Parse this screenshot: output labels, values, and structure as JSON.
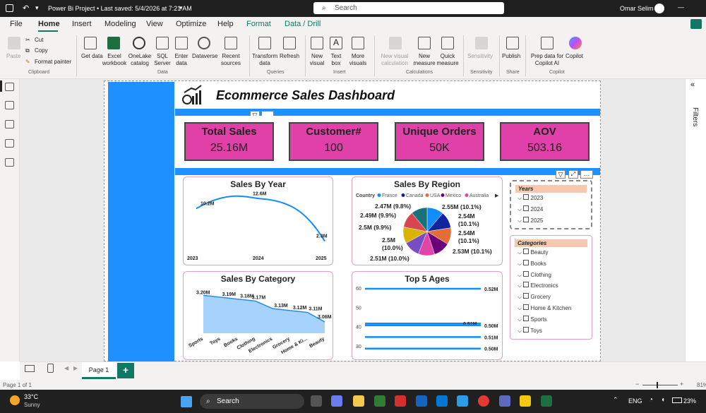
{
  "titlebar": {
    "title": "Power Bi Project • Last saved: 5/4/2026 at 7:21 AM",
    "search": "Search",
    "user": "Omar Selim"
  },
  "menu": [
    "File",
    "Home",
    "Insert",
    "Modeling",
    "View",
    "Optimize",
    "Help",
    "Format",
    "Data / Drill"
  ],
  "ribbon": {
    "clipboard": {
      "paste": "Paste",
      "cut": "Cut",
      "copy": "Copy",
      "format_painter": "Format painter",
      "group": "Clipboard"
    },
    "data": {
      "get_data": "Get data",
      "excel": "Excel workbook",
      "onelake": "OneLake catalog",
      "sql": "SQL Server",
      "enter": "Enter data",
      "dataverse": "Dataverse",
      "recent": "Recent sources",
      "group": "Data"
    },
    "queries": {
      "transform": "Transform data",
      "refresh": "Refresh",
      "group": "Queries"
    },
    "insert": {
      "new_visual": "New visual",
      "text_box": "Text box",
      "more_visuals": "More visuals",
      "group": "Insert"
    },
    "calculations": {
      "new_visual_calc": "New visual calculation",
      "new_measure": "New measure",
      "quick_measure": "Quick measure",
      "group": "Calculations"
    },
    "sensitivity": {
      "label": "Sensitivity",
      "group": "Sensitivity"
    },
    "share": {
      "publish": "Publish",
      "group": "Share"
    },
    "copilot": {
      "prep": "Prep data for Copilot AI",
      "copilot": "Copilot",
      "group": "Copilot"
    }
  },
  "dashboard": {
    "title": "Ecommerce Sales Dashboard",
    "kpis": [
      {
        "title": "Total Sales",
        "value": "25.16M"
      },
      {
        "title": "Customer#",
        "value": "100"
      },
      {
        "title": "Unique Orders",
        "value": "50K"
      },
      {
        "title": "AOV",
        "value": "503.16"
      }
    ]
  },
  "charts": {
    "sales_by_year": {
      "title": "Sales By Year",
      "type": "line",
      "categories": [
        "2023",
        "2024",
        "2025"
      ],
      "values": [
        10.2,
        12.6,
        2.3
      ],
      "labels": [
        "10.2M",
        "12.6M",
        "2.3M"
      ]
    },
    "sales_by_region": {
      "title": "Sales By Region",
      "type": "pie",
      "legend_title": "Country",
      "legend": [
        "France",
        "Canada",
        "USA",
        "Mexico",
        "Australia"
      ],
      "labels": [
        "2.55M (10.1%)",
        "2.54M (10.1%)",
        "2.54M (10.1%)",
        "2.53M (10.1%)",
        "2.51M (10.0%)",
        "2.5M (10.0%)",
        "2.5M (9.9%)",
        "2.49M (9.9%)",
        "2.47M (9.8%)"
      ],
      "label_lines": [
        [
          "2.55M (10.1%)"
        ],
        [
          "2.54M",
          "(10.1%)"
        ],
        [
          "2.54M",
          "(10.1%)"
        ],
        [
          "2.53M (10.1%)"
        ],
        [
          "2.51M (10.0%)"
        ],
        [
          "2.5M",
          "(10.0%)"
        ],
        [
          "2.5M (9.9%)"
        ],
        [
          "2.49M (9.9%)"
        ],
        [
          "2.47M (9.8%)"
        ]
      ],
      "values": [
        2.55,
        2.54,
        2.54,
        2.53,
        2.51,
        2.5,
        2.5,
        2.49,
        2.47
      ],
      "colors": [
        "#118dff",
        "#12239e",
        "#e66c37",
        "#6b007b",
        "#e044a7",
        "#744ec2",
        "#d9b300",
        "#d64550",
        "#197278"
      ]
    },
    "sales_by_category": {
      "title": "Sales By Category",
      "type": "area",
      "categories": [
        "Sports",
        "Toys",
        "Books",
        "Clothing",
        "Electronics",
        "Grocery",
        "Home & Ki...",
        "Beauty"
      ],
      "values": [
        3.2,
        3.19,
        3.18,
        3.17,
        3.13,
        3.12,
        3.11,
        3.06
      ],
      "labels": [
        "3.20M",
        "3.19M",
        "3.18M",
        "3.17M",
        "3.13M",
        "3.12M",
        "3.11M",
        "3.06M"
      ]
    },
    "top_5_ages": {
      "title": "Top 5 Ages",
      "type": "line",
      "y_ticks": [
        "60",
        "50",
        "40",
        "30"
      ],
      "lines": [
        {
          "y": 60,
          "label": "0.52M"
        },
        {
          "y": 42,
          "label": "0.51M"
        },
        {
          "y": 41,
          "label": "0.50M"
        },
        {
          "y": 35,
          "label": "0.51M"
        },
        {
          "y": 29,
          "label": "0.50M"
        }
      ]
    }
  },
  "slicers": {
    "years": {
      "title": "Years",
      "items": [
        "2023",
        "2024",
        "2025"
      ]
    },
    "categories": {
      "title": "Categories",
      "items": [
        "Beauty",
        "Books",
        "Clothing",
        "Electronics",
        "Grocery",
        "Home & Kitchen",
        "Sports",
        "Toys"
      ]
    }
  },
  "filters_label": "Filters",
  "pagebar": {
    "page": "Page 1",
    "add": "+"
  },
  "status": {
    "page": "Page 1 of 1",
    "zoom": "81%"
  },
  "taskbar": {
    "temp": "33°C",
    "weather": "Sunny",
    "search": "Search",
    "lang": "ENG",
    "battery": "23%"
  }
}
